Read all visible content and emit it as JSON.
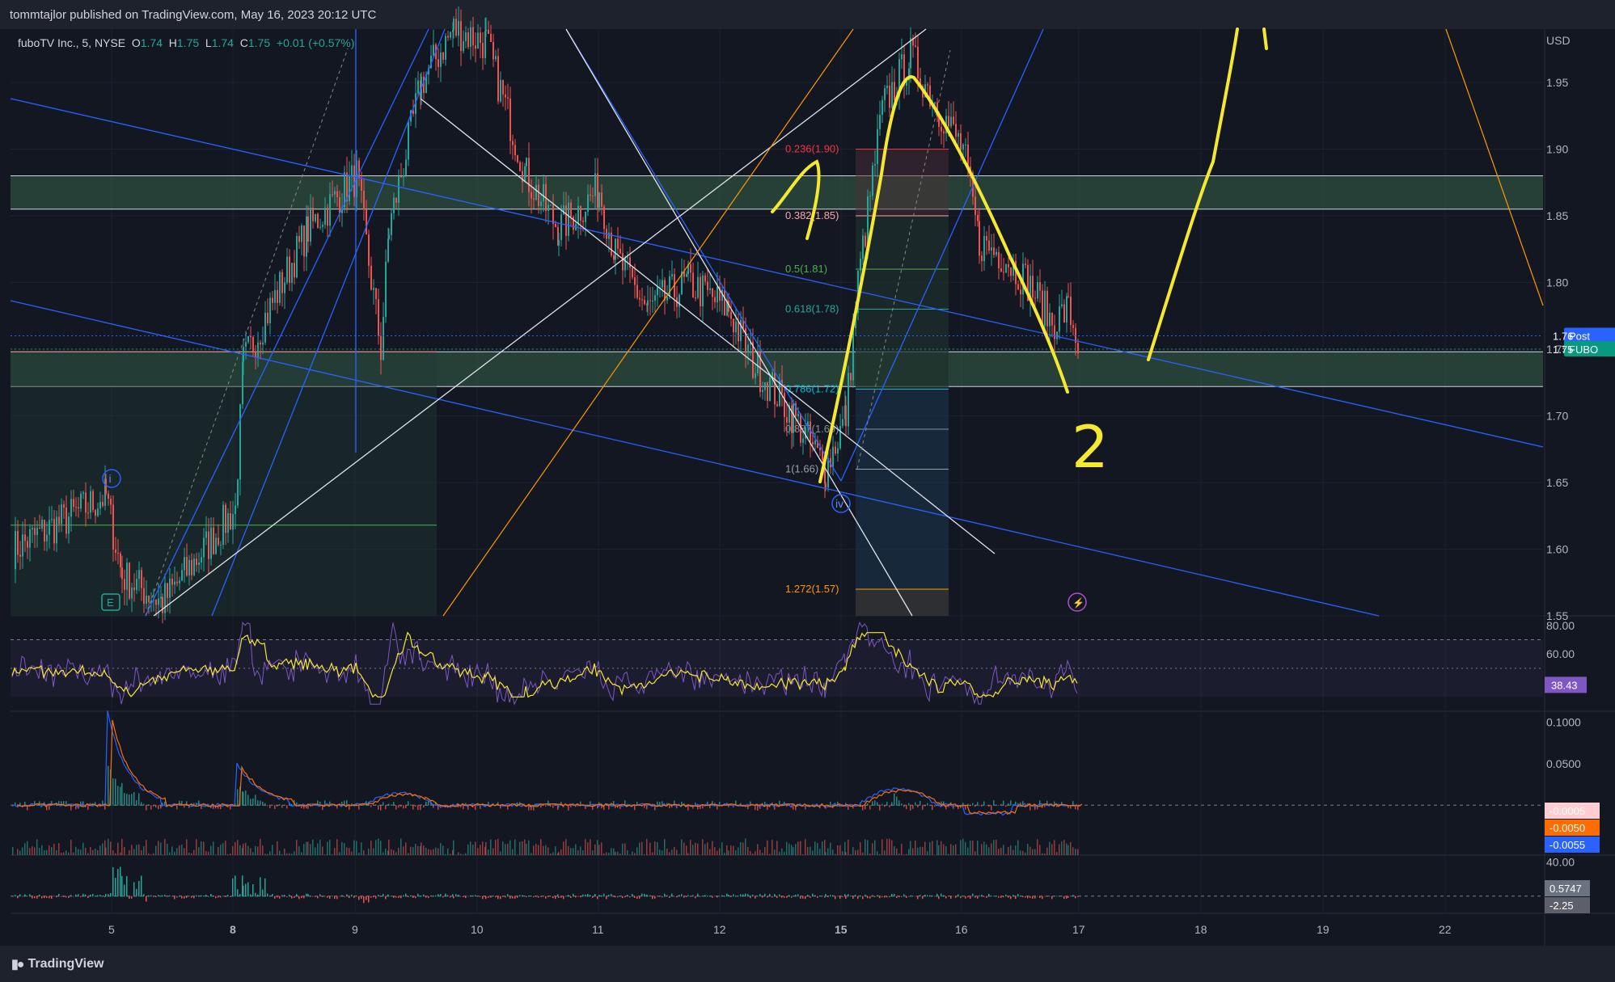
{
  "header": {
    "publish_line": "tommtajlor published on TradingView.com, May 16, 2023 20:12 UTC"
  },
  "legend": {
    "symbol": "fuboTV Inc., 5, NYSE",
    "o_label": "O",
    "o_value": "1.74",
    "h_label": "H",
    "h_value": "1.75",
    "l_label": "L",
    "l_value": "1.74",
    "c_label": "C",
    "c_value": "1.75",
    "change": "+0.01 (+0.57%)"
  },
  "footer": {
    "brand": "TradingView"
  },
  "colors": {
    "background": "#131722",
    "up": "#26a69a",
    "down": "#ef5350",
    "trend_blue": "#2962ff",
    "annotation_yellow": "#f5e830",
    "rsi_purple": "#7e57c2",
    "zone_green": "#2f4f3f"
  },
  "chart_data": [
    {
      "type": "line",
      "panel": "price",
      "title": "",
      "y_axis_unit": "USD",
      "y_ticks": [
        "1.95",
        "1.90",
        "1.85",
        "1.80",
        "1.75",
        "1.70",
        "1.65",
        "1.60",
        "1.55"
      ],
      "ylim": [
        1.55,
        1.99
      ],
      "x_ticks": [
        "5",
        "8",
        "9",
        "10",
        "11",
        "12",
        "15",
        "16",
        "17",
        "18",
        "19",
        "22"
      ],
      "series": [
        {
          "x": [
            "5",
            "8",
            "9",
            "10",
            "11",
            "12",
            "15",
            "16",
            "17"
          ],
          "values": [
            1.64,
            1.62,
            1.88,
            1.98,
            1.85,
            1.78,
            1.7,
            1.92,
            1.76
          ]
        }
      ],
      "fib_levels": [
        {
          "label": "0.236(1.90)",
          "value": 1.9,
          "color": "#f23645"
        },
        {
          "label": "0.382(1.85)",
          "value": 1.85,
          "color": "#f7a6a6"
        },
        {
          "label": "0.5(1.81)",
          "value": 1.81,
          "color": "#4caf50"
        },
        {
          "label": "0.618(1.78)",
          "value": 1.78,
          "color": "#26a69a"
        },
        {
          "label": "0.786(1.72)",
          "value": 1.72,
          "color": "#00bcd4"
        },
        {
          "label": "0.887(1.69)",
          "value": 1.69,
          "color": "#8090a0"
        },
        {
          "label": "1(1.66)",
          "value": 1.66,
          "color": "#9aa0aa"
        },
        {
          "label": "1.272(1.57)",
          "value": 1.57,
          "color": "#ff9800"
        }
      ],
      "price_badges": [
        {
          "label": "Post",
          "value": "1.76",
          "color": "#2962ff"
        },
        {
          "label": "FUBO",
          "value": "1.75",
          "color": "#089981"
        }
      ],
      "wave_labels": [
        "i",
        "iv",
        "E"
      ],
      "annotations": [
        "2"
      ]
    },
    {
      "type": "line",
      "panel": "rsi",
      "title": "",
      "y_ticks": [
        "80.00",
        "60.00"
      ],
      "ylim": [
        20,
        85
      ],
      "current_value": "38.43"
    },
    {
      "type": "line",
      "panel": "macd",
      "title": "",
      "y_ticks": [
        "0.1000",
        "0.0500"
      ],
      "ylim": [
        -0.06,
        0.11
      ],
      "current_values": [
        "-0.0005",
        "-0.0050",
        "-0.0055"
      ]
    },
    {
      "type": "bar",
      "panel": "oscillator",
      "title": "",
      "y_ticks": [
        "40.00"
      ],
      "ylim": [
        -20,
        45
      ],
      "current_values": [
        "0.5747",
        "-2.25"
      ]
    }
  ]
}
